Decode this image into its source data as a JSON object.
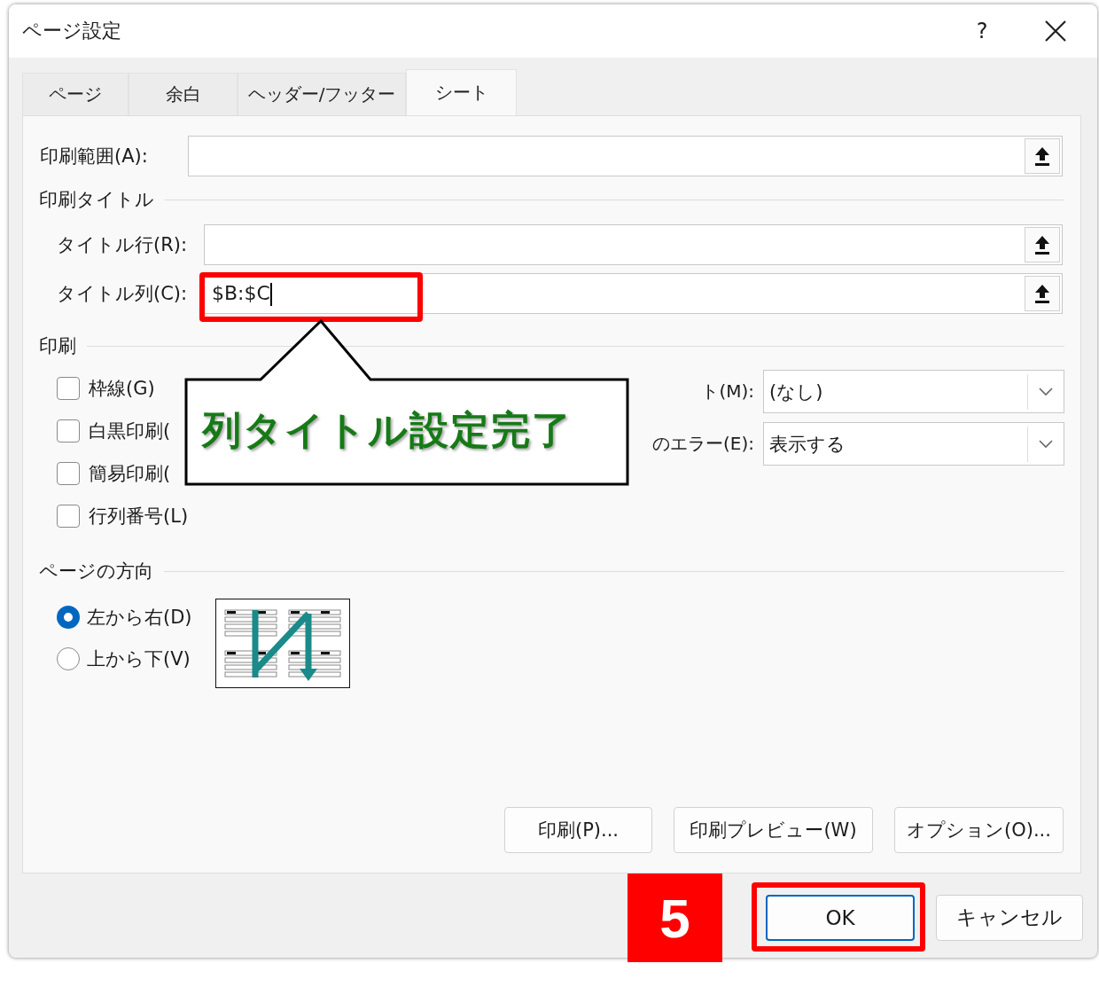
{
  "dialog": {
    "title": "ページ設定",
    "help": "?"
  },
  "tabs": [
    {
      "label": "ページ",
      "selected": false
    },
    {
      "label": "余白",
      "selected": false
    },
    {
      "label": "ヘッダー/フッター",
      "selected": false
    },
    {
      "label": "シート",
      "selected": true
    }
  ],
  "print_area": {
    "label": "印刷範囲(A):"
  },
  "print_titles": {
    "heading": "印刷タイトル",
    "rows": [
      {
        "label": "タイトル行(R):",
        "highlighted": false
      },
      {
        "label": "タイトル列(C):",
        "value": "$B:$C",
        "highlighted": true
      }
    ]
  },
  "print": {
    "heading": "印刷",
    "checkboxes": [
      {
        "label": "枠線(G)",
        "checked": false
      },
      {
        "label": "白黒印刷(",
        "checked": false
      },
      {
        "label": "簡易印刷(",
        "checked": false
      },
      {
        "label": "行列番号(L)",
        "checked": false
      }
    ],
    "dropdowns": [
      {
        "label": "ト(M):",
        "value": "(なし)"
      },
      {
        "label": "のエラー(E):",
        "value": "表示する"
      }
    ]
  },
  "page_order": {
    "heading": "ページの方向",
    "options": [
      {
        "label": "左から右(D)",
        "selected": true
      },
      {
        "label": "上から下(V)",
        "selected": false
      }
    ]
  },
  "panel_buttons": [
    "印刷(P)...",
    "印刷プレビュー(W)",
    "オプション(O)..."
  ],
  "footer_buttons": [
    {
      "label": "OK",
      "default": true,
      "highlighted": true
    },
    {
      "label": "キャンセル",
      "default": false,
      "highlighted": false
    }
  ],
  "annotations": {
    "callout": "列タイトル設定完了",
    "step": "5"
  }
}
